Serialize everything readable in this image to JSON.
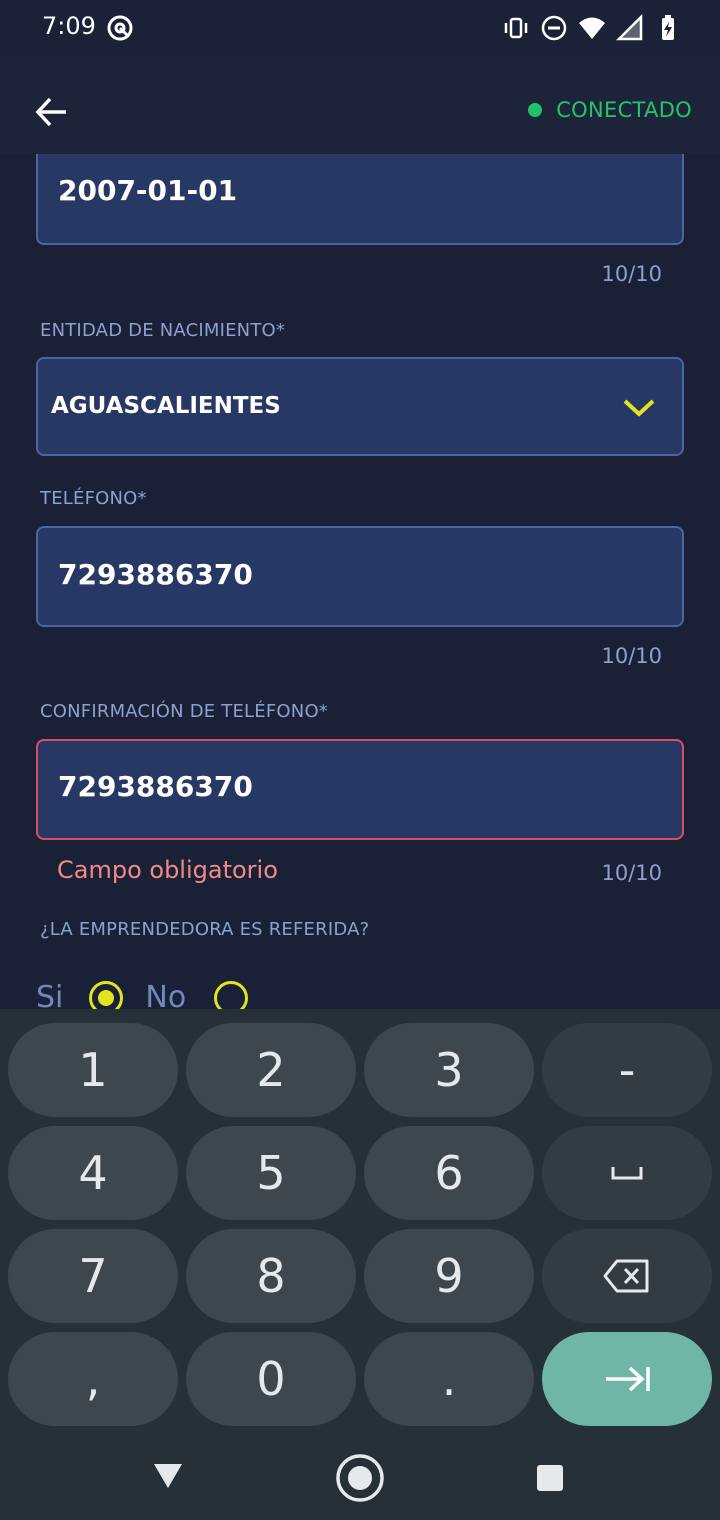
{
  "status_bar": {
    "time": "7:09",
    "icons": [
      "at-sign-icon",
      "vibrate-icon",
      "do-not-disturb-icon",
      "wifi-icon",
      "signal-icon",
      "battery-icon"
    ]
  },
  "app_bar": {
    "back_icon": "arrow-left-icon",
    "connection_status": "CONECTADO",
    "connection_color": "#24c46c"
  },
  "form": {
    "birth_date": {
      "value": "2007-01-01",
      "counter": "10/10"
    },
    "birth_state": {
      "label": "ENTIDAD DE NACIMIENTO*",
      "value": "AGUASCALIENTES"
    },
    "phone": {
      "label": "TELÉFONO*",
      "value": "7293886370",
      "counter": "10/10"
    },
    "phone_confirm": {
      "label": "CONFIRMACIÓN DE TELÉFONO*",
      "value": "7293886370",
      "counter": "10/10",
      "error": "Campo obligatorio"
    },
    "referred": {
      "label": "¿LA EMPRENDEDORA ES REFERIDA?",
      "options": [
        "Si",
        "No"
      ],
      "selected": "Si"
    }
  },
  "keyboard": {
    "row1": [
      "1",
      "2",
      "3",
      "-"
    ],
    "row2": [
      "4",
      "5",
      "6",
      "space"
    ],
    "row3": [
      "7",
      "8",
      "9",
      "backspace"
    ],
    "row4": [
      ",",
      "0",
      ".",
      "next"
    ]
  },
  "colors": {
    "background": "#1a2035",
    "field_fill": "#283865",
    "field_border": "#4b64a3",
    "error": "#e04a62",
    "accent_radio": "#e2e51d",
    "keyboard_action": "#6fb5a8"
  }
}
